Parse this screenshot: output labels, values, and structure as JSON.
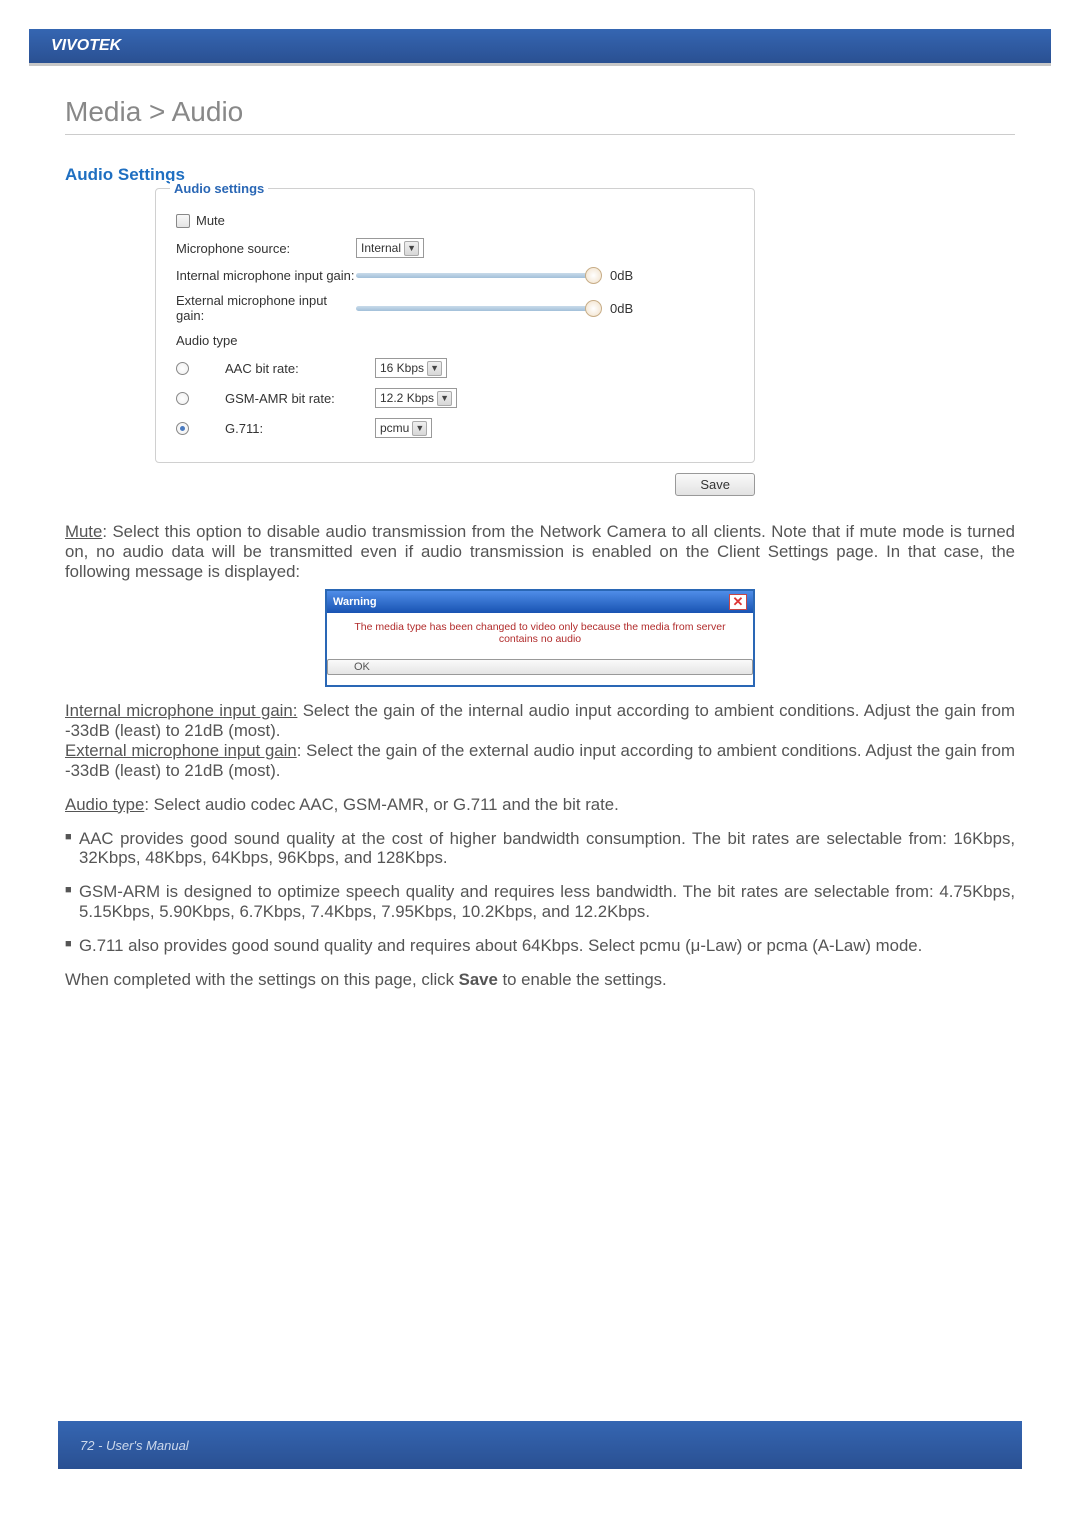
{
  "brand": "VIVOTEK",
  "page_title": "Media > Audio",
  "section_title": "Audio Settings",
  "panel": {
    "legend": "Audio settings",
    "mute_label": "Mute",
    "mute_checked": false,
    "mic_source_label": "Microphone source:",
    "mic_source_value": "Internal",
    "int_gain_label": "Internal microphone input gain:",
    "int_gain_value": "0dB",
    "ext_gain_label": "External microphone input gain:",
    "ext_gain_value": "0dB",
    "audio_type_label": "Audio type",
    "aac_label": "AAC bit rate:",
    "aac_value": "16 Kbps",
    "gsm_label": "GSM-AMR bit rate:",
    "gsm_value": "12.2 Kbps",
    "g711_label": "G.711:",
    "g711_value": "pcmu",
    "selected_codec": "g711"
  },
  "save_label": "Save",
  "mute_desc_label": "Mute",
  "mute_desc_text": ": Select this option to disable audio transmission from the Network Camera to all clients. Note that if mute mode is turned on, no audio data will be transmitted even if audio transmission is enabled on the Client Settings page. In that case, the following message is displayed:",
  "warning": {
    "title": "Warning",
    "body": "The media type has been changed to video only because the media from server contains no audio",
    "ok": "OK"
  },
  "int_gain_desc_label": "Internal microphone input gain:",
  "int_gain_desc_text": " Select the gain of the internal audio input according to ambient conditions. Adjust the gain from -33dB (least) to 21dB (most).",
  "ext_gain_desc_label": "External microphone input gain",
  "ext_gain_desc_text": ": Select the gain of the external audio input according to ambient conditions. Adjust the gain from -33dB (least) to 21dB (most).",
  "audio_type_desc_label": "Audio type",
  "audio_type_desc_text": ": Select audio codec AAC, GSM-AMR, or G.711 and the bit rate.",
  "codec_bullets": {
    "aac": "AAC provides good sound quality at the cost of higher bandwidth consumption. The bit rates are selectable from: 16Kbps, 32Kbps, 48Kbps, 64Kbps, 96Kbps, and 128Kbps.",
    "gsm": "GSM-ARM is designed to optimize speech quality and requires less bandwidth. The bit rates are selectable from: 4.75Kbps, 5.15Kbps, 5.90Kbps, 6.7Kbps, 7.4Kbps, 7.95Kbps, 10.2Kbps, and 12.2Kbps.",
    "g711": "G.711 also provides good sound quality and requires about 64Kbps. Select pcmu (μ-Law) or pcma (A-Law) mode."
  },
  "closing_pre": "When completed with the settings on this page, click ",
  "closing_bold": "Save",
  "closing_post": " to enable the settings.",
  "footer": "72 - User's Manual"
}
